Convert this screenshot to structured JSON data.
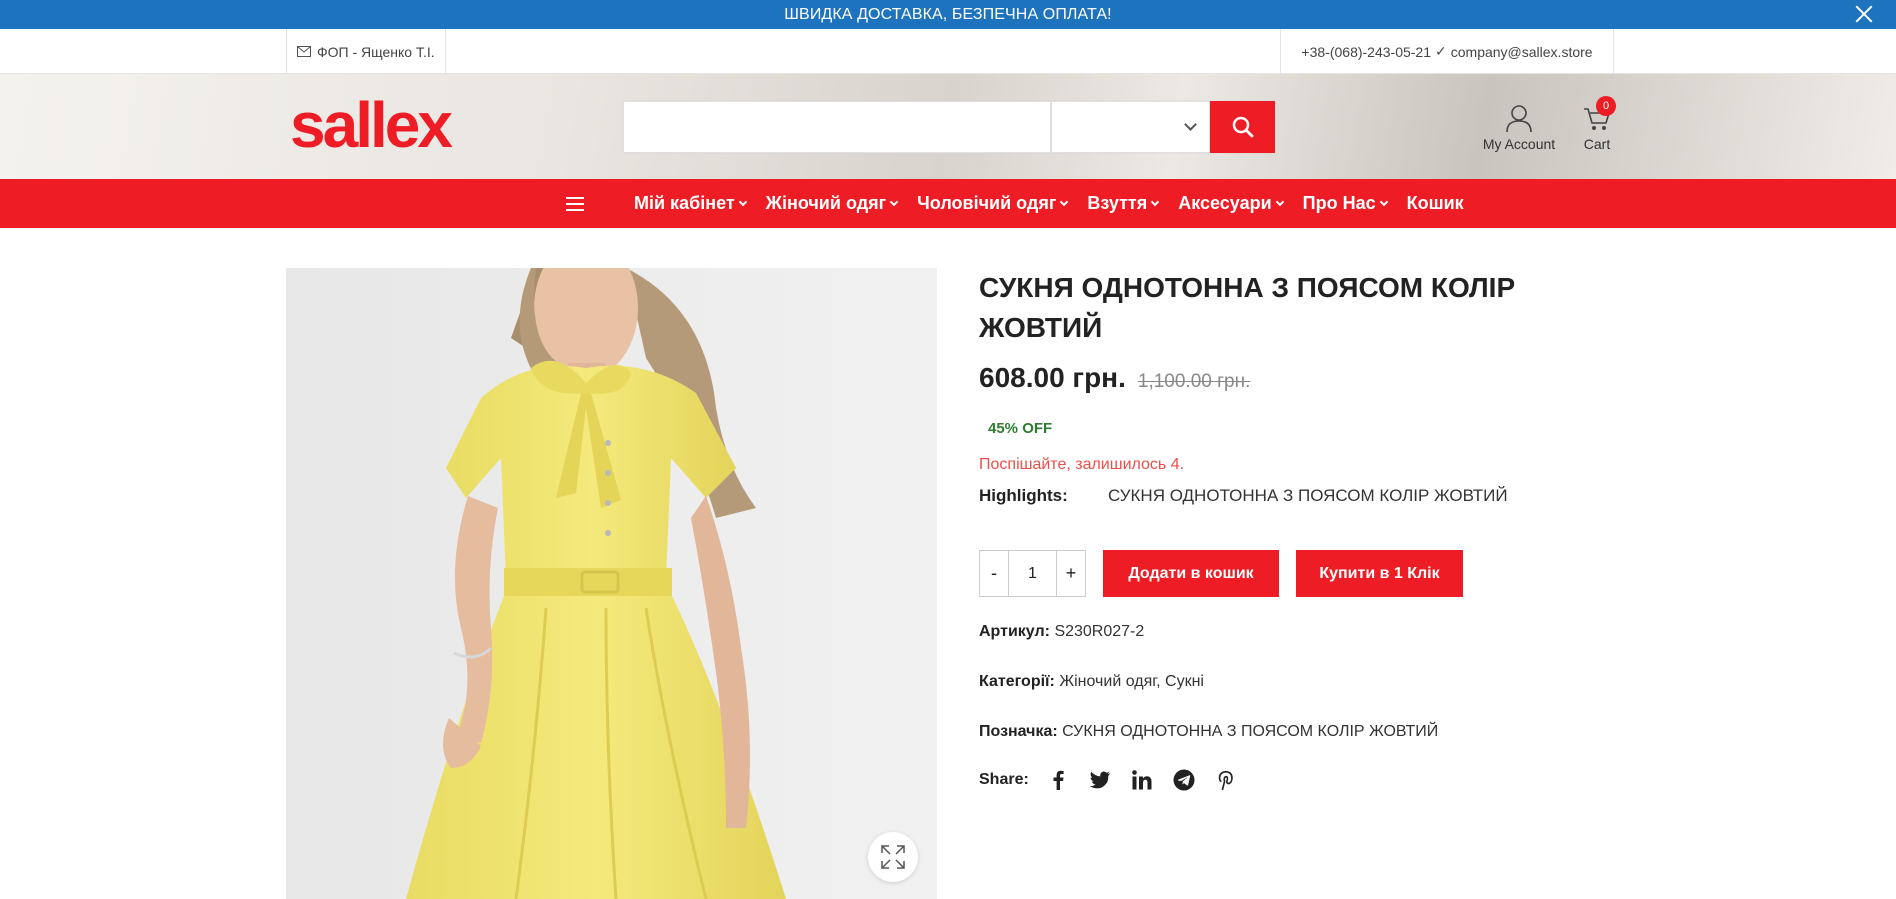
{
  "announcement": {
    "text": "ШВИДКА ДОСТАВКА, БЕЗПЕЧНА ОПЛАТА!"
  },
  "info_bar": {
    "company": "ФОП - Ященко Т.І.",
    "phone": "+38-(068)-243-05-21",
    "email": "company@sallex.store"
  },
  "header": {
    "logo": "sallex",
    "search": {
      "placeholder": "",
      "category": ""
    },
    "account_label": "My Account",
    "cart_label": "Cart",
    "cart_count": "0"
  },
  "nav": {
    "items": [
      {
        "label": "Мій кабінет",
        "dropdown": true
      },
      {
        "label": "Жіночий одяг",
        "dropdown": true
      },
      {
        "label": "Чоловічий одяг",
        "dropdown": true
      },
      {
        "label": "Взуття",
        "dropdown": true
      },
      {
        "label": "Аксесуари",
        "dropdown": true
      },
      {
        "label": "Про Нас",
        "dropdown": true
      },
      {
        "label": "Кошик",
        "dropdown": false
      }
    ]
  },
  "product": {
    "title": "СУКНЯ ОДНОТОННА З ПОЯСОМ КОЛІР ЖОВТИЙ",
    "price": "608.00 грн.",
    "old_price": "1,100.00 грн.",
    "discount": "45% OFF",
    "stock_notice": "Поспішайте, залишилось 4.",
    "highlights_label": "Highlights:",
    "highlights_value": "СУКНЯ ОДНОТОННА З ПОЯСОМ КОЛІР ЖОВТИЙ",
    "quantity": "1",
    "qty_minus": "-",
    "qty_plus": "+",
    "add_to_cart": "Додати в кошик",
    "buy_one_click": "Купити в 1 Клік",
    "sku_label": "Артикул:",
    "sku": "S230R027-2",
    "categories_label": "Категорії:",
    "category_1": "Жіночий одяг",
    "category_sep": ",",
    "category_2": "Сукні",
    "tag_label": "Позначка:",
    "tag": "СУКНЯ ОДНОТОННА З ПОЯСОМ КОЛІР ЖОВТИЙ",
    "share_label": "Share:",
    "share_icons": [
      "facebook-icon",
      "twitter-icon",
      "linkedin-icon",
      "telegram-icon",
      "pinterest-icon"
    ]
  },
  "colors": {
    "brand_red": "#ee1c25",
    "topbar_blue": "#1e73be",
    "discount_green": "#2e7d32",
    "stock_red": "#e8504a"
  }
}
